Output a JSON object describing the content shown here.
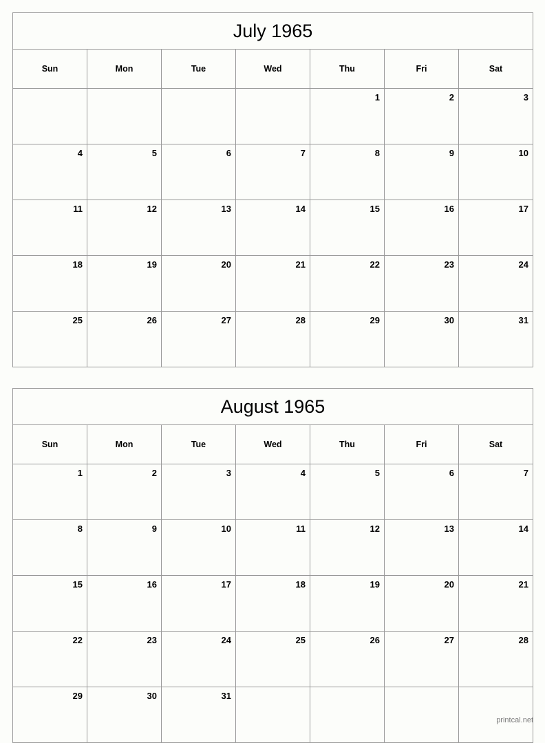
{
  "page": {
    "background_color": "#fcfdfa",
    "border_color": "#999999",
    "text_color": "#000000"
  },
  "calendars": [
    {
      "title": "July 1965",
      "weekdays": [
        "Sun",
        "Mon",
        "Tue",
        "Wed",
        "Thu",
        "Fri",
        "Sat"
      ],
      "weeks": [
        [
          "",
          "",
          "",
          "",
          "1",
          "2",
          "3"
        ],
        [
          "4",
          "5",
          "6",
          "7",
          "8",
          "9",
          "10"
        ],
        [
          "11",
          "12",
          "13",
          "14",
          "15",
          "16",
          "17"
        ],
        [
          "18",
          "19",
          "20",
          "21",
          "22",
          "23",
          "24"
        ],
        [
          "25",
          "26",
          "27",
          "28",
          "29",
          "30",
          "31"
        ]
      ]
    },
    {
      "title": "August 1965",
      "weekdays": [
        "Sun",
        "Mon",
        "Tue",
        "Wed",
        "Thu",
        "Fri",
        "Sat"
      ],
      "weeks": [
        [
          "1",
          "2",
          "3",
          "4",
          "5",
          "6",
          "7"
        ],
        [
          "8",
          "9",
          "10",
          "11",
          "12",
          "13",
          "14"
        ],
        [
          "15",
          "16",
          "17",
          "18",
          "19",
          "20",
          "21"
        ],
        [
          "22",
          "23",
          "24",
          "25",
          "26",
          "27",
          "28"
        ],
        [
          "29",
          "30",
          "31",
          "",
          "",
          "",
          ""
        ]
      ]
    }
  ],
  "footer": {
    "source_label": "printcal.net"
  }
}
